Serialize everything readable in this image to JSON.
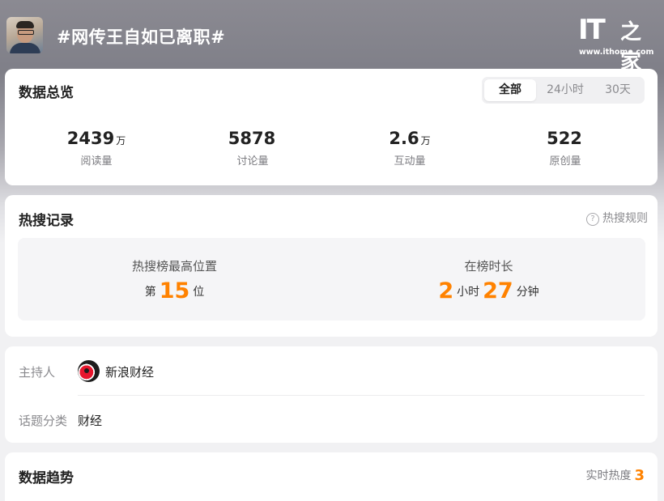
{
  "header": {
    "topic_title": "#网传王自如已离职#",
    "logo_mark": "IT",
    "logo_cn": "之家",
    "logo_url": "www.ithome.com"
  },
  "overview": {
    "title": "数据总览",
    "filters": [
      "全部",
      "24小时",
      "30天"
    ],
    "active_filter": "全部",
    "stats": [
      {
        "value": "2439",
        "unit": "万",
        "label": "阅读量"
      },
      {
        "value": "5878",
        "unit": "",
        "label": "讨论量"
      },
      {
        "value": "2.6",
        "unit": "万",
        "label": "互动量"
      },
      {
        "value": "522",
        "unit": "",
        "label": "原创量"
      }
    ]
  },
  "hot_search": {
    "title": "热搜记录",
    "rules_label": "热搜规则",
    "peak_label": "热搜榜最高位置",
    "peak_prefix": "第",
    "peak_value": "15",
    "peak_suffix": "位",
    "duration_label": "在榜时长",
    "duration_hours": "2",
    "hours_unit": "小时",
    "duration_minutes": "27",
    "minutes_unit": "分钟"
  },
  "info": {
    "host_label": "主持人",
    "host_name": "新浪财经",
    "category_label": "话题分类",
    "category_value": "财经"
  },
  "trend": {
    "title": "数据趋势",
    "realtime_label": "实时热度",
    "realtime_value": "3"
  },
  "colors": {
    "accent_orange": "#ff8200",
    "card_bg": "#ffffff",
    "page_bg": "#f1f1f3"
  }
}
